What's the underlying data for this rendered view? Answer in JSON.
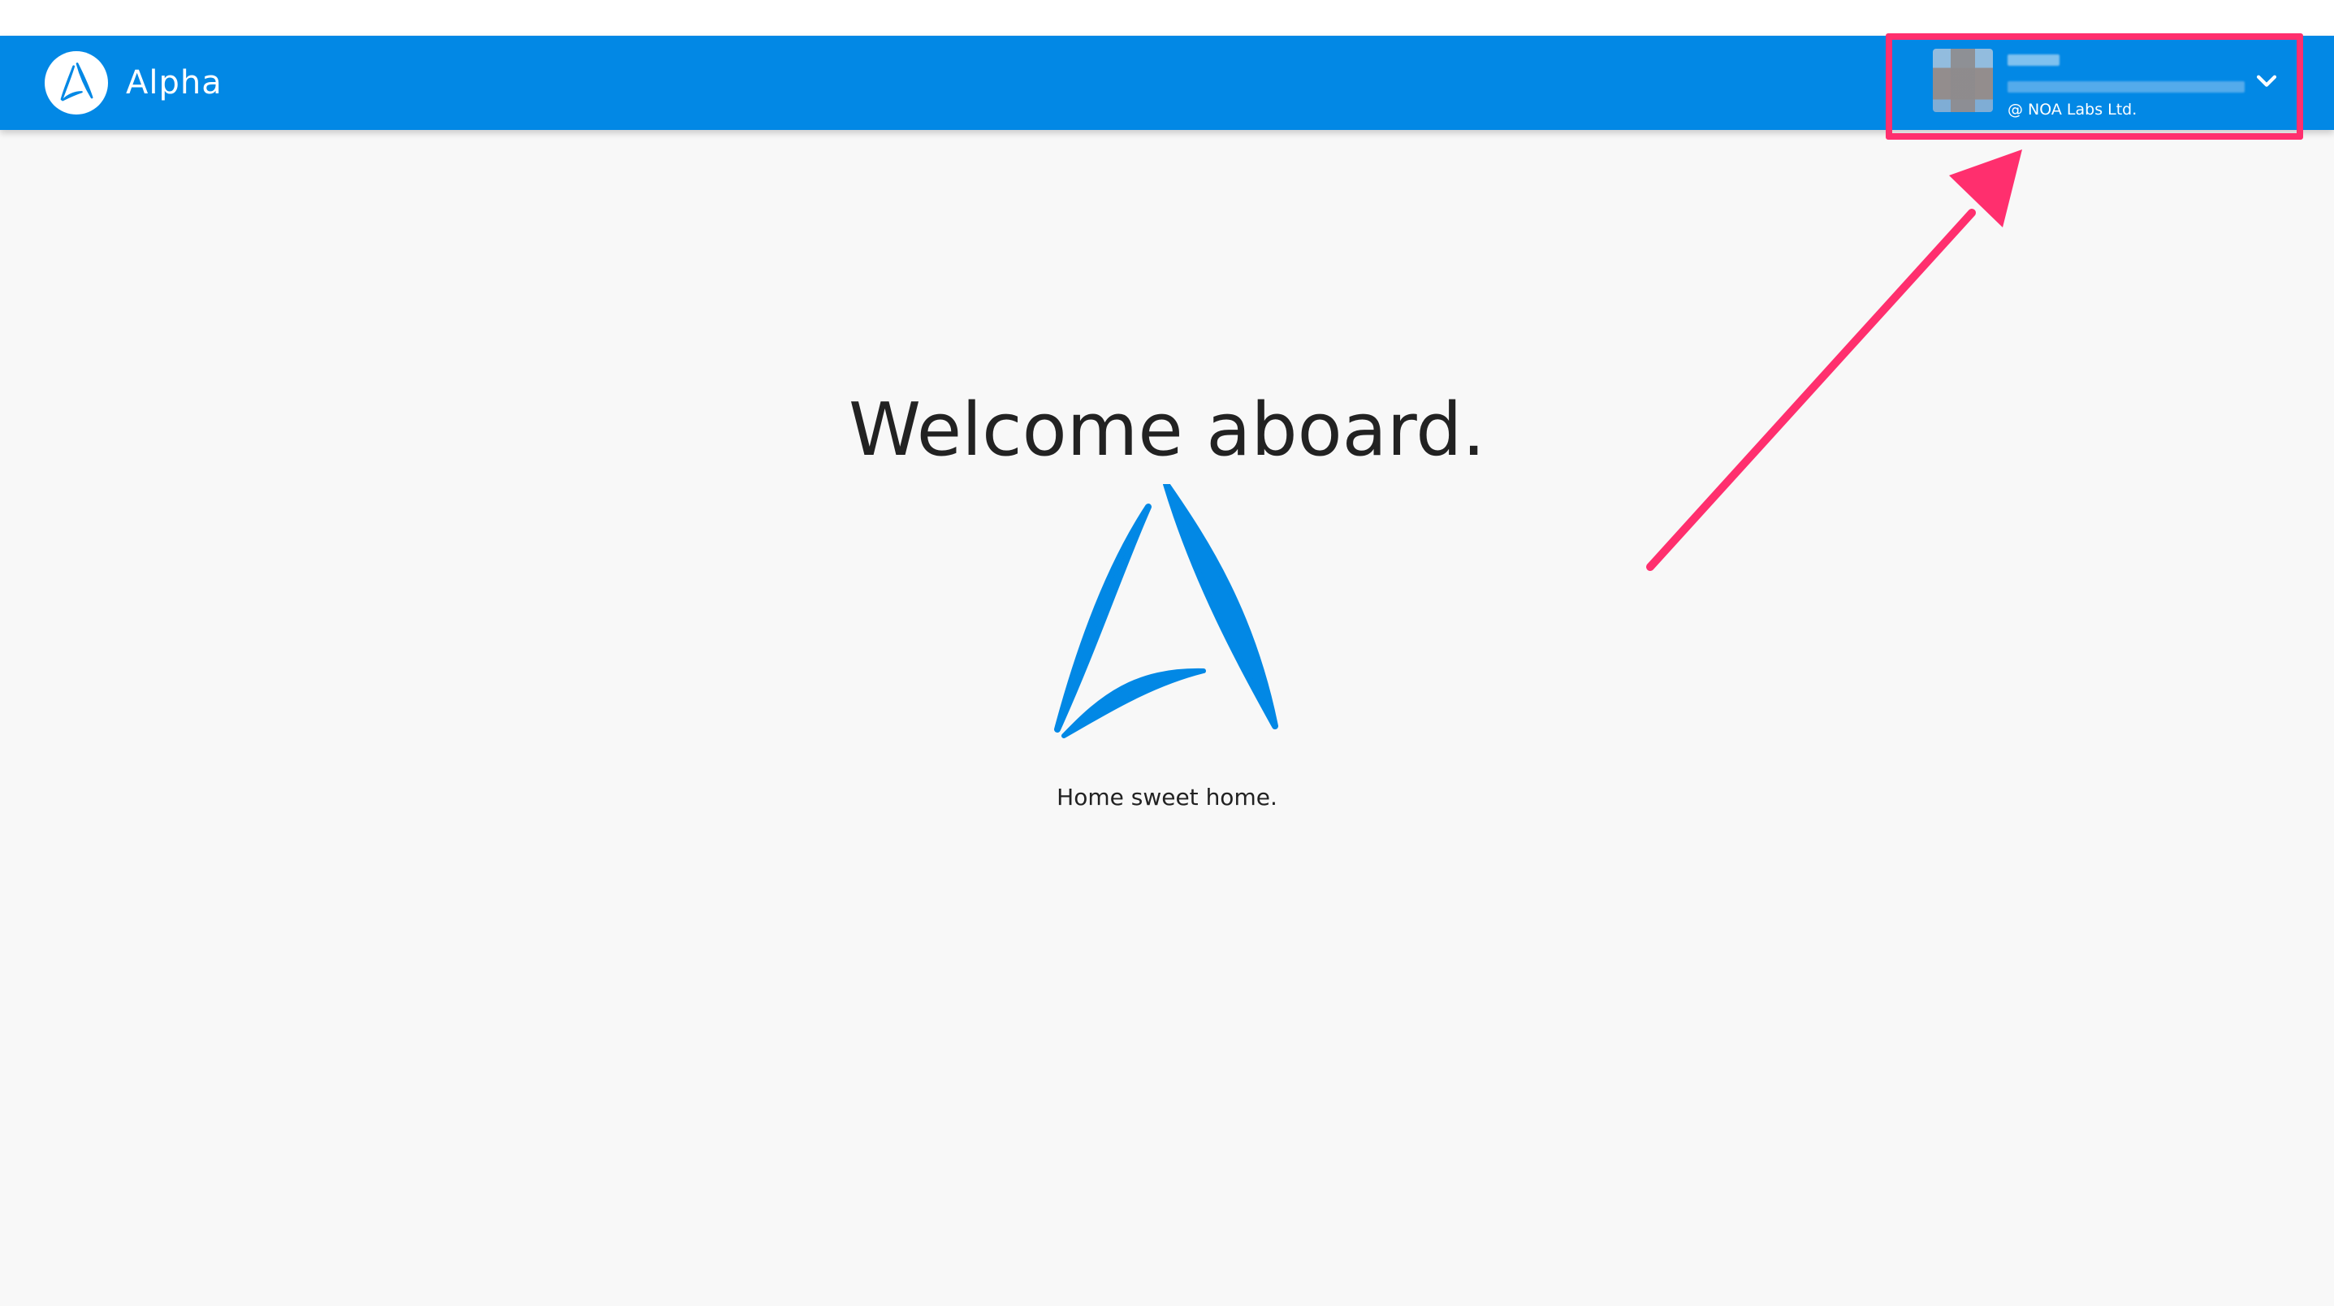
{
  "header": {
    "brand_name": "Alpha",
    "background_color": "#0288e5"
  },
  "user_menu": {
    "organization": "@ NOA Labs Ltd.",
    "expand_icon": "chevron-down-icon"
  },
  "main": {
    "title": "Welcome aboard.",
    "tagline": "Home sweet home."
  },
  "annotation": {
    "color": "#ff2f6e"
  }
}
